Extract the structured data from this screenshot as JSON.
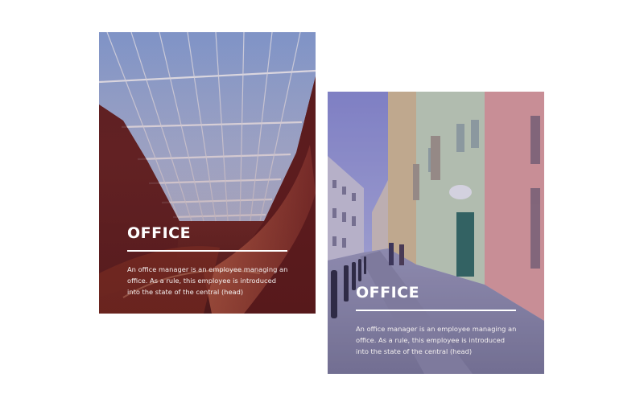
{
  "cards": [
    {
      "title": "OFFICE",
      "description": "An office manager is an employee managing an office. As a rule, this employee is introduced into the state of the central (head)",
      "image": "glass-atrium-roof-photo",
      "tint_color": "#6e1e1e"
    },
    {
      "title": "OFFICE",
      "description": "An office manager is an employee managing an office. As a rule, this employee is introduced into the state of the central (head)",
      "image": "city-street-photo",
      "tint_color": "#463c8c"
    }
  ],
  "colors": {
    "background": "#ffffff",
    "text": "#ffffff"
  }
}
